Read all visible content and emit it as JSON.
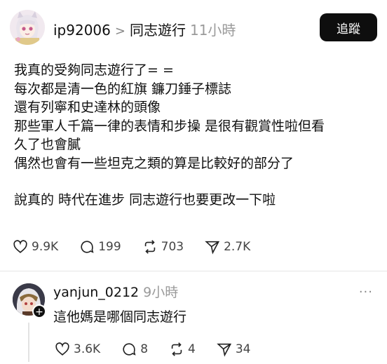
{
  "post": {
    "username": "ip92006",
    "separator": ">",
    "topic": "同志遊行",
    "time": "11小時",
    "follow_label": "追蹤",
    "lines": [
      "我真的受夠同志遊行了= =",
      "每次都是清一色的紅旗 鐮刀錘子標誌",
      "還有列寧和史達林的頭像",
      "那些軍人千篇一律的表情和步操 是很有觀賞性啦但看",
      "久了也會膩",
      "偶然也會有一些坦克之類的算是比較好的部分了"
    ],
    "last_line": "說真的 時代在進步 同志遊行也要更改一下啦",
    "stats": {
      "likes": "9.9K",
      "comments": "199",
      "reposts": "703",
      "shares": "2.7K"
    }
  },
  "reply": {
    "username": "yanjun_0212",
    "time": "9小時",
    "text": "這他媽是哪個同志遊行",
    "more": "···",
    "stats": {
      "likes": "3.6K",
      "comments": "8",
      "reposts": "4",
      "shares": "34"
    }
  },
  "icons": [
    "heart-icon",
    "comment-icon",
    "repost-icon",
    "share-icon",
    "more-icon",
    "plus-icon"
  ],
  "colors": {
    "follow_bg": "#0e0e0e",
    "muted": "#9a9a9a",
    "text": "#101010"
  }
}
